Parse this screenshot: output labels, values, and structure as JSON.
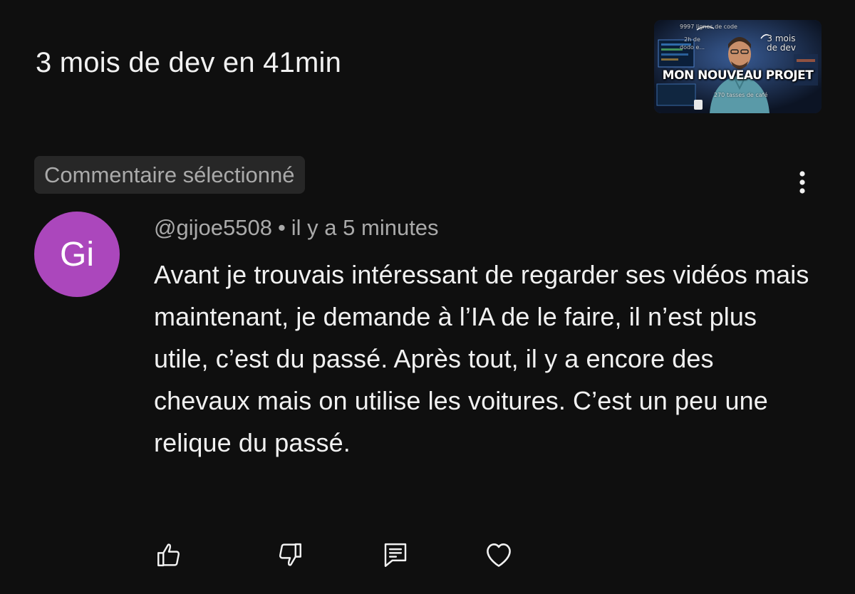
{
  "video": {
    "title": "3 mois de dev en 41min",
    "thumbnail": {
      "headline": "MON NOUVEAU PROJET",
      "top_left_text": "9997 lignes de code",
      "left_text": "2h de\ndodo e...",
      "right_text": "3 mois\nde dev",
      "bottom_text": "270 tasses de café"
    }
  },
  "comment": {
    "selected_label": "Commentaire sélectionné",
    "avatar_initials": "Gi",
    "author": "@gijoe5508",
    "separator": "•",
    "timestamp": "il y a 5 minutes",
    "text": "Avant je trouvais intéressant de regarder ses vidéos mais maintenant, je demande à l’IA de le faire, il n’est plus utile, c’est du passé. Après tout, il y a encore des chevaux mais on utilise les voitures. C’est un peu une relique du passé."
  },
  "actions": [
    {
      "icon": "thumbs-up-icon"
    },
    {
      "icon": "thumbs-down-icon"
    },
    {
      "icon": "reply-icon"
    },
    {
      "icon": "heart-icon"
    }
  ],
  "colors": {
    "background": "#0f0f0f",
    "text_primary": "#f1f1f1",
    "text_secondary": "#aaaaaa",
    "chip_background": "#272727",
    "avatar_background": "#ab47bc"
  }
}
